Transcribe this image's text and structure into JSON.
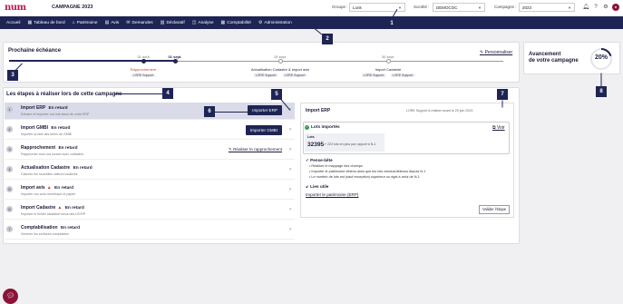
{
  "header": {
    "logo": "num",
    "campaign_title": "CAMPAGNE 2023",
    "groupe_label": "Groupe :",
    "groupe_value": "Lonk",
    "societe_label": "Société :",
    "societe_value": "DEMOCOC",
    "campagne_label": "Campagne :",
    "campagne_value": "2023"
  },
  "nav": [
    {
      "label": "Accueil",
      "icon": ""
    },
    {
      "label": "Tableau de bord",
      "icon": "▦"
    },
    {
      "label": "Patrimoine",
      "icon": "⌂"
    },
    {
      "label": "Avis",
      "icon": "▤"
    },
    {
      "label": "Demandes",
      "icon": "✉"
    },
    {
      "label": "Déclaratif",
      "icon": "▥"
    },
    {
      "label": "Analyse",
      "icon": "◫"
    },
    {
      "label": "Comptabilité",
      "icon": "▦"
    },
    {
      "label": "Administration",
      "icon": "⚙"
    }
  ],
  "markers": [
    "1",
    "2",
    "3",
    "4",
    "5",
    "6",
    "7",
    "8"
  ],
  "echeance": {
    "title": "Prochaine échéance",
    "personnaliser": "Personnaliser",
    "dates": [
      "31 août",
      "01 sept.",
      "15 sept.",
      "30 sept."
    ],
    "events": [
      {
        "label": "Rapprochement",
        "badge": "LORE Support"
      },
      {
        "label": "Actualisation Cadastre & import avis",
        "badge1": "LORE Support",
        "badge2": "LORE Support"
      },
      {
        "label": "Import Cadastre",
        "badge1": "LORE Support",
        "badge2": "LORE Support"
      }
    ]
  },
  "avancement": {
    "title_line1": "Avancement",
    "title_line2": "de votre campagne",
    "percent": "20%",
    "progress_fraction": 0.2
  },
  "steps": {
    "title": "Les étapes à réaliser lors de cette campagne",
    "items": [
      {
        "num": "1",
        "name": "Import ERP",
        "status": "En retard",
        "desc": "Extraire et importer vos lots issus de votre ERP",
        "action": "Importer ERP"
      },
      {
        "num": "2",
        "name": "Import GMBI",
        "status": "En retard",
        "desc": "Importer la liste des biens de GMBI",
        "action": "Importer GMBI"
      },
      {
        "num": "3",
        "name": "Rapprochement",
        "status": "En retard",
        "desc": "Rapprocher tous vos locaux avec cotisation",
        "action": "Réaliser le rapprochement"
      },
      {
        "num": "4",
        "name": "Actualisation Cadastre",
        "status": "En retard",
        "desc": "Calculer les nouvelles valeurs locatives",
        "action": ""
      },
      {
        "num": "5",
        "name": "Import avis",
        "status": "En retard",
        "desc": "Importer vos avis numérique et papier",
        "action": ""
      },
      {
        "num": "6",
        "name": "Import Cadastre",
        "status": "En retard",
        "desc": "Importer le fichier cadastrel issus des DGFIP",
        "action": ""
      },
      {
        "num": "7",
        "name": "Comptabilisation",
        "status": "En retard",
        "desc": "Générer les écritures comptables",
        "action": ""
      }
    ]
  },
  "detail": {
    "title": "Import ERP",
    "meta": "LORE Support   A réaliser avant le 29 juin 2023",
    "lots_title": "Lots importés",
    "voir": "Voir",
    "lots_label": "Lots",
    "lots_value": "32395",
    "lots_trend": "223 lots en plus par rapport à N-1",
    "pense_bete_title": "Pense-bête",
    "pense_bete": [
      "Réaliser le mappage des champs",
      "Importer le patrimoine détenu ainsi que les lots vendus/détenus depuis N-1",
      "Le nombre de lots est (sauf exception) supérieur ou égal à celui de N-1"
    ],
    "lien_utile_title": "Lien utile",
    "lien_utile": "Importer le patrimoine (ERP)",
    "valider": "Valider l'étape"
  }
}
